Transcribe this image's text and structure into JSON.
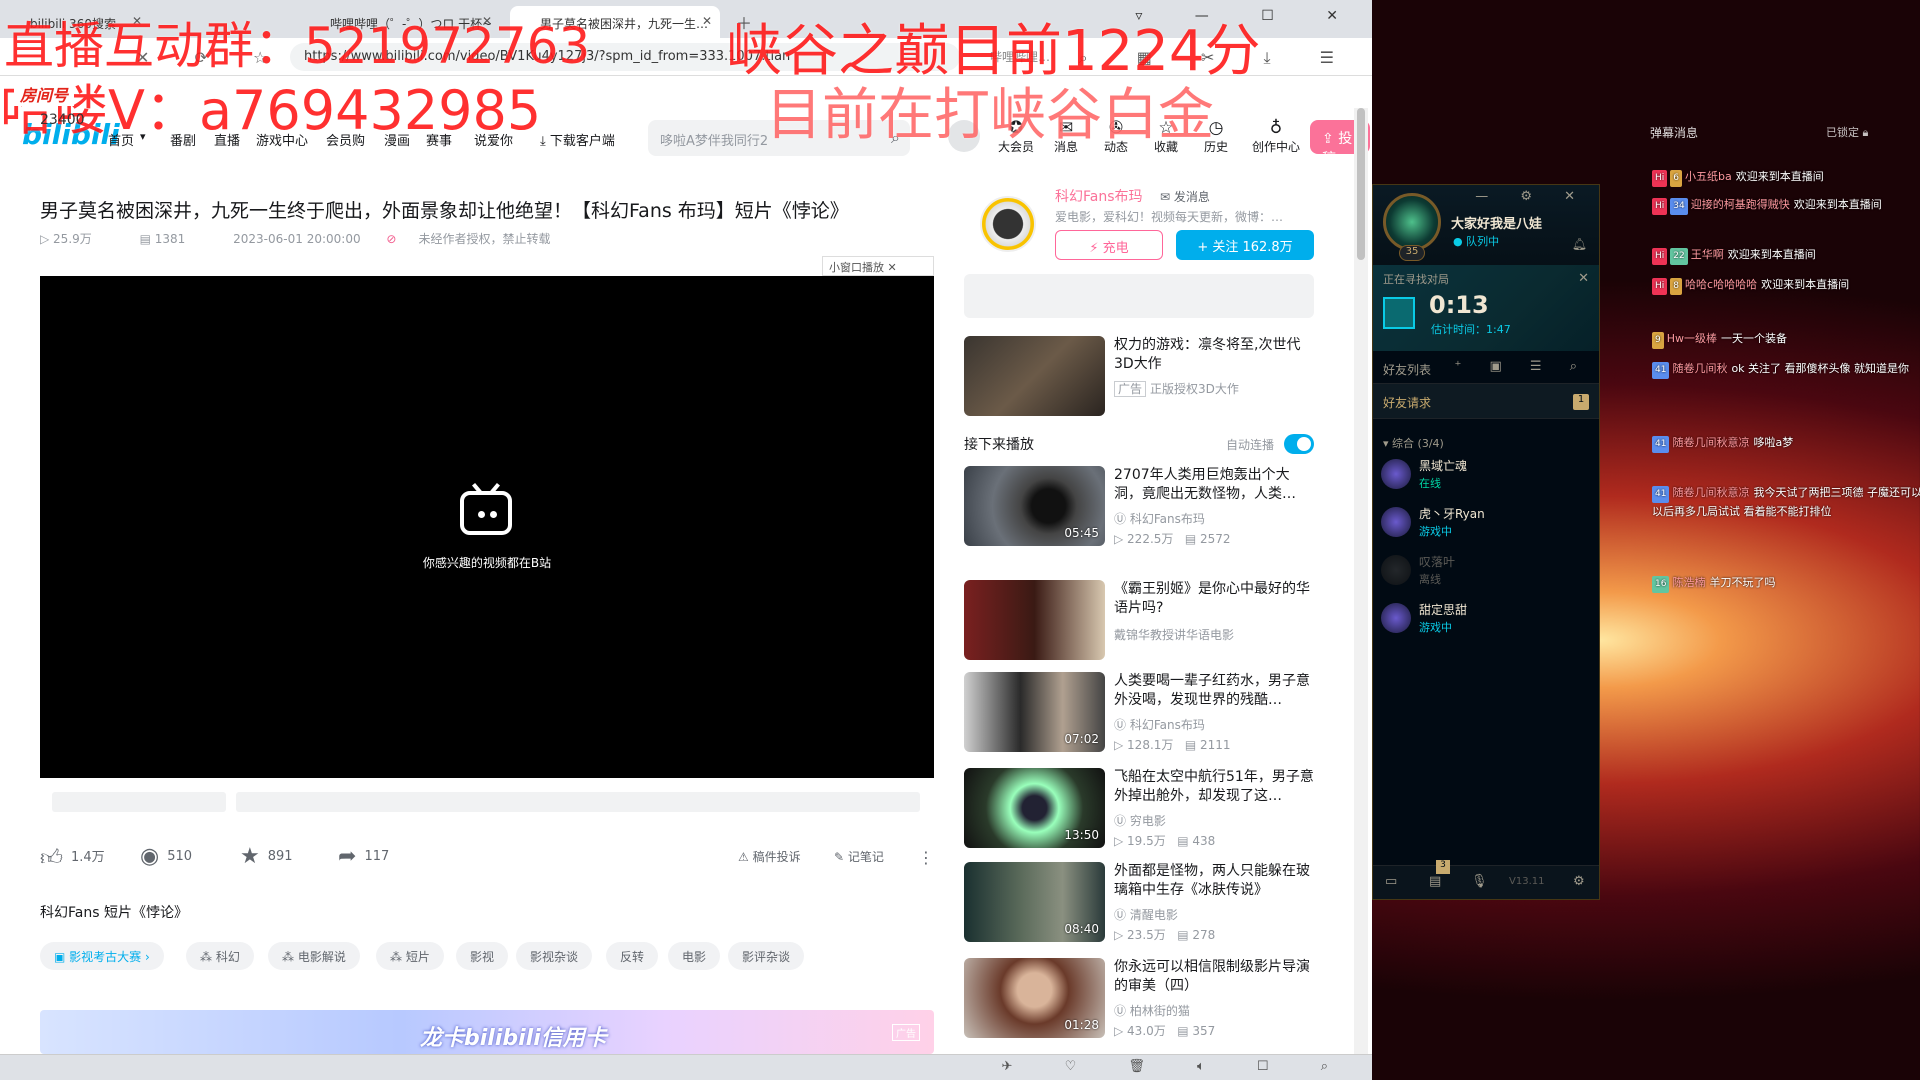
{
  "browser": {
    "tabs": [
      {
        "label": "bilibili 360搜索"
      },
      {
        "label": "哔哩哔哩（゜-゜）つロ 干杯~"
      },
      {
        "label": "男子莫名被困深井，九死一生…"
      }
    ],
    "url": "https://www.bilibili.com/video/BV1Ku4y127j3/?spm_id_from=333.1007.tian",
    "search_placeholder": "哔哩哔哩…"
  },
  "bili": {
    "logo": "bilibili",
    "nav": [
      "首页",
      "番剧",
      "直播",
      "游戏中心",
      "会员购",
      "漫画",
      "赛事",
      "说爱你",
      "下载客户端"
    ],
    "search_placeholder": "哆啦A梦伴我同行2",
    "header_icons": [
      "大会员",
      "消息",
      "动态",
      "收藏",
      "历史",
      "创作中心"
    ],
    "upload": "投稿"
  },
  "video": {
    "title": "男子莫名被困深井，九死一生终于爬出，外面景象却让他绝望！【科幻Fans 布玛】短片《悖论》",
    "views": "25.9万",
    "danmaku": "1381",
    "date": "2023-06-01 20:00:00",
    "copyright": "未经作者授权，禁止转载",
    "mini_player": "小窗口播放",
    "player_tip": "你感兴趣的视频都在B站",
    "likes": "1.4万",
    "coins": "510",
    "favorites": "891",
    "shares": "117",
    "report": "稿件投诉",
    "notes": "记笔记",
    "description": "科幻Fans 短片《悖论》",
    "tags": [
      "影视考古大赛",
      "科幻",
      "电影解说",
      "短片",
      "影视",
      "影视杂谈",
      "反转",
      "电影",
      "影评杂谈"
    ],
    "ad_banner": "龙卡bilibili信用卡",
    "ad_label": "广告"
  },
  "uploader": {
    "name": "科幻Fans布玛",
    "message": "发消息",
    "desc": "爱电影，爱科幻！视频每天更新，微博：…",
    "charge": "充电",
    "follow": "+ 关注 162.8万"
  },
  "ad_card": {
    "title": "权力的游戏：凛冬将至,次世代3D大作",
    "label": "广告",
    "sub": "正版授权3D大作"
  },
  "next_up": {
    "label": "接下来播放",
    "autoplay": "自动连播"
  },
  "recommendations": [
    {
      "title": "2707年人类用巨炮轰出个大洞，竟爬出无数怪物，人类…",
      "owner": "科幻Fans布玛",
      "views": "222.5万",
      "danmaku": "2572",
      "duration": "05:45"
    },
    {
      "title": "《霸王别姬》是你心中最好的华语片吗?",
      "owner": "戴锦华教授讲华语电影",
      "views": "",
      "danmaku": "",
      "duration": ""
    },
    {
      "title": "人类要喝一辈子红药水，男子意外没喝，发现世界的残酷…",
      "owner": "科幻Fans布玛",
      "views": "128.1万",
      "danmaku": "2111",
      "duration": "07:02"
    },
    {
      "title": "飞船在太空中航行51年，男子意外掉出舱外，却发现了这…",
      "owner": "穷电影",
      "views": "19.5万",
      "danmaku": "438",
      "duration": "13:50"
    },
    {
      "title": "外面都是怪物，两人只能躲在玻璃箱中生存《冰肤传说》",
      "owner": "清醒电影",
      "views": "23.5万",
      "danmaku": "278",
      "duration": "08:40"
    },
    {
      "title": "你永远可以相信限制级影片导演的审美（四）",
      "owner": "柏林街的猫",
      "views": "43.0万",
      "danmaku": "357",
      "duration": "01:28"
    }
  ],
  "lol": {
    "name": "大家好我是八娃",
    "status": "队列中",
    "level": "35",
    "queue_label": "正在寻找对局",
    "timer": "0:13",
    "estimate": "估计时间：1:47",
    "friends_label": "好友列表",
    "friend_requests": "好友请求",
    "friend_requests_count": "1",
    "group": "综合 (3/4)",
    "friends": [
      {
        "name": "黑域亡魂",
        "status": "在线",
        "color": "#01d7a6"
      },
      {
        "name": "虎丶牙Ryan",
        "status": "游戏中",
        "color": "#0acbe6"
      },
      {
        "name": "叹落叶",
        "status": "离线",
        "color": "#5b5a56"
      },
      {
        "name": "甜定思甜",
        "status": "游戏中",
        "color": "#0acbe6"
      }
    ],
    "footer_badge": "3",
    "version": "V13.11"
  },
  "danmaku_panel": {
    "title": "弹幕消息",
    "lock": "已锁定",
    "messages": [
      {
        "level": "6",
        "user": "小五纸ba",
        "text": "欢迎来到本直播间"
      },
      {
        "level": "34",
        "user": "迎接的柯基跑得贼快",
        "text": "欢迎来到本直播间"
      },
      {
        "level": "22",
        "user": "王华啊",
        "text": "欢迎来到本直播间"
      },
      {
        "level": "8",
        "user": "哈哈c哈哈哈哈",
        "text": "欢迎来到本直播间"
      },
      {
        "level": "9",
        "user": "Hw一级棒",
        "text": "一天一个装备"
      },
      {
        "level": "41",
        "user": "随卷几间秋",
        "text": "ok 关注了 看那傻杯头像 就知道是你"
      },
      {
        "level": "41",
        "user": "随卷几间秋意凉",
        "text": "哆啦a梦"
      },
      {
        "level": "41",
        "user": "随卷几间秋意凉",
        "text": "我今天试了两把三项德 子魔还可以 以后再多几局试试 看着能不能打排位"
      },
      {
        "level": "16",
        "user": "陈浩楠",
        "text": "羊刀不玩了吗"
      }
    ]
  },
  "overlay": {
    "group_text": "直播互动群：521972763",
    "contact_text": "哈喽V：a769432985",
    "rank_text": "峡谷之巅目前1224分",
    "status_text": "目前在打峡谷白金",
    "room_label": "房间号",
    "room_number": "23400"
  }
}
